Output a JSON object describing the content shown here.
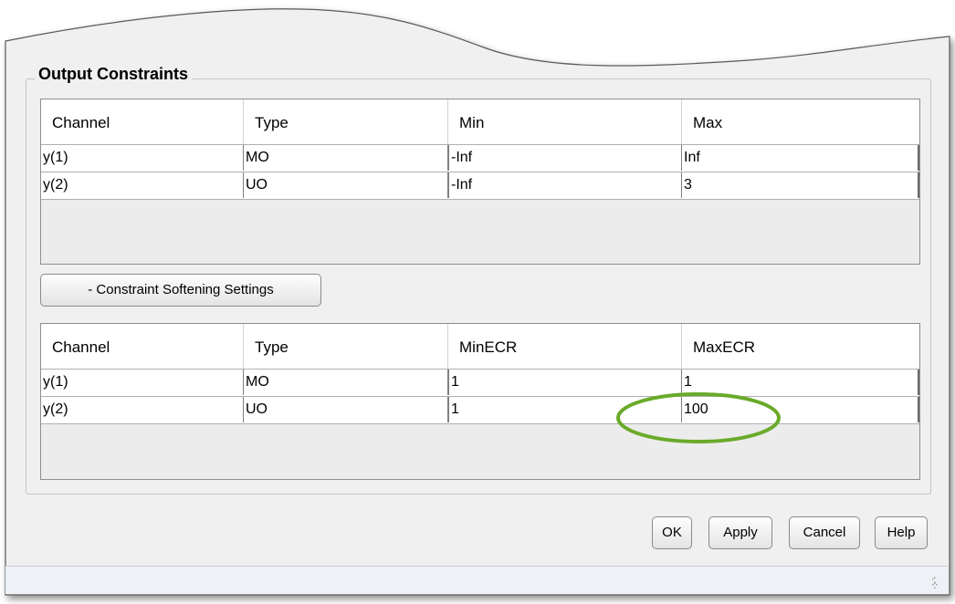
{
  "output_constraints": {
    "title": "Output Constraints",
    "columns": [
      "Channel",
      "Type",
      "Min",
      "Max"
    ],
    "rows": [
      {
        "channel": "y(1)",
        "type": "MO",
        "min": "-Inf",
        "max": "Inf"
      },
      {
        "channel": "y(2)",
        "type": "UO",
        "min": "-Inf",
        "max": "3"
      }
    ]
  },
  "softening": {
    "toggle_label": "- Constraint Softening Settings",
    "columns": [
      "Channel",
      "Type",
      "MinECR",
      "MaxECR"
    ],
    "rows": [
      {
        "channel": "y(1)",
        "type": "MO",
        "min_ecr": "1",
        "max_ecr": "1"
      },
      {
        "channel": "y(2)",
        "type": "UO",
        "min_ecr": "1",
        "max_ecr": "100"
      }
    ]
  },
  "buttons": {
    "ok": "OK",
    "apply": "Apply",
    "cancel": "Cancel",
    "help": "Help"
  },
  "colors": {
    "dialog_bg": "#f0f0f0",
    "highlight_ellipse": "#6aaa2a"
  }
}
